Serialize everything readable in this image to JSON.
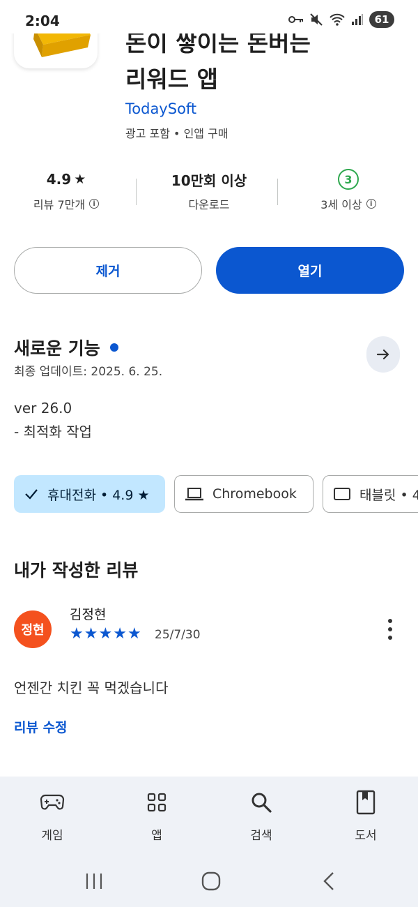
{
  "status_bar": {
    "time": "2:04",
    "battery": "61",
    "icons": [
      "key-icon",
      "mute-icon",
      "wifi-icon",
      "signal-icon"
    ]
  },
  "app": {
    "title_line1": "돈이 쌓이는 돈버는",
    "title_line2": "리워드 앱",
    "developer": "TodaySoft",
    "meta": "광고 포함 • 인앱 구매"
  },
  "stats": {
    "rating_value": "4.9",
    "rating_label": "리뷰 7만개",
    "downloads_value": "10만회 이상",
    "downloads_label": "다운로드",
    "age_value": "3",
    "age_label": "3세 이상"
  },
  "buttons": {
    "uninstall": "제거",
    "open": "열기"
  },
  "whats_new": {
    "title": "새로운 기능",
    "updated": "최종 업데이트: 2025. 6. 25.",
    "version": "ver 26.0",
    "note": "- 최적화 작업"
  },
  "device_chips": [
    {
      "label": "휴대전화 • 4.9 ★",
      "selected": true
    },
    {
      "label": "Chromebook",
      "selected": false
    },
    {
      "label": "태블릿 • 4",
      "selected": false
    }
  ],
  "my_review": {
    "title": "내가 작성한 리뷰",
    "avatar_text": "정현",
    "reviewer": "김정현",
    "stars": 5,
    "date": "25/7/30",
    "text": "언젠간 치킨 꼭 먹겠습니다",
    "edit_label": "리뷰 수정"
  },
  "bottom_nav": [
    {
      "label": "게임",
      "icon": "gamepad-icon"
    },
    {
      "label": "앱",
      "icon": "apps-grid-icon"
    },
    {
      "label": "검색",
      "icon": "search-icon"
    },
    {
      "label": "도서",
      "icon": "book-icon"
    }
  ],
  "colors": {
    "accent": "#0b57d0",
    "chip_selected": "#c2e7ff",
    "avatar": "#f4511e",
    "age_badge": "#2fa84f",
    "nav_bg": "#eff2f7"
  }
}
